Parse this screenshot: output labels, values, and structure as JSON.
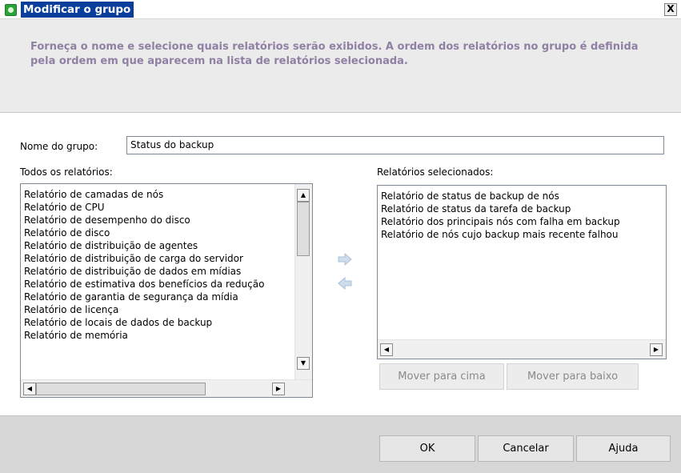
{
  "window": {
    "title": "Modificar o grupo",
    "close_label": "X"
  },
  "header": {
    "description": "Forneça o nome e selecione quais relatórios serão exibidos. A ordem dos relatórios no grupo é definida pela ordem em que aparecem na lista de relatórios selecionada."
  },
  "form": {
    "group_name_label": "Nome do grupo:",
    "group_name_value": "Status do backup"
  },
  "all_reports": {
    "label": "Todos os relatórios:",
    "items": [
      "Relatório de camadas de nós",
      "Relatório de CPU",
      "Relatório de desempenho do disco",
      "Relatório de disco",
      "Relatório de distribuição de agentes",
      "Relatório de distribuição de carga do servidor",
      "Relatório de distribuição de dados em mídias",
      "Relatório de estimativa dos benefícios da redução",
      "Relatório de garantia de segurança da mídia",
      "Relatório de licença",
      "Relatório de locais de dados de backup",
      "Relatório de memória"
    ]
  },
  "selected_reports": {
    "label": "Relatórios selecionados:",
    "items": [
      "Relatório de status de backup de nós",
      "Relatório de status da tarefa de backup",
      "Relatório dos principais nós com falha em backup",
      "Relatório de nós cujo backup mais recente falhou"
    ]
  },
  "icons": {
    "add": "arrow-right-icon",
    "remove": "arrow-left-icon",
    "app": "app-icon",
    "scroll_up": "scroll-up-icon",
    "scroll_down": "scroll-down-icon",
    "scroll_left": "scroll-left-icon",
    "scroll_right": "scroll-right-icon"
  },
  "buttons": {
    "move_up": "Mover para cima",
    "move_down": "Mover para baixo",
    "ok": "OK",
    "cancel": "Cancelar",
    "help": "Ajuda"
  },
  "colors": {
    "title_highlight": "#0a3e9c",
    "header_text": "#8f80a4",
    "arrow": "#a8c0d8"
  }
}
